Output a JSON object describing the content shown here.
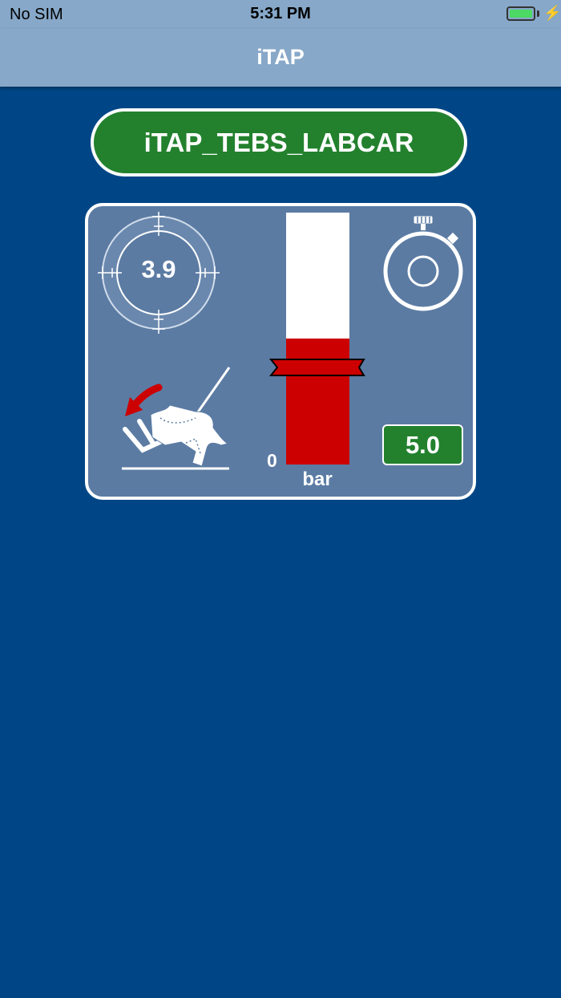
{
  "status_bar": {
    "carrier": "No SIM",
    "time": "5:31 PM",
    "battery_level": 1.0
  },
  "nav": {
    "title": "iTAP"
  },
  "device": {
    "name": "iTAP_TEBS_LABCAR"
  },
  "panel": {
    "gauge_value": "3.9",
    "pressure_bar": {
      "fill_fraction": 0.5,
      "min_label": "0",
      "unit": "bar",
      "color": "#cc0000"
    },
    "setpoint_value": "5.0"
  },
  "colors": {
    "background": "#004686",
    "bars": "#87a8c8",
    "accent_green": "#23812e",
    "panel": "#5b7ba3"
  },
  "icons": [
    "crosshair-gauge-icon",
    "stopwatch-icon",
    "brake-pedal-foot-icon",
    "pressure-marker-icon"
  ]
}
